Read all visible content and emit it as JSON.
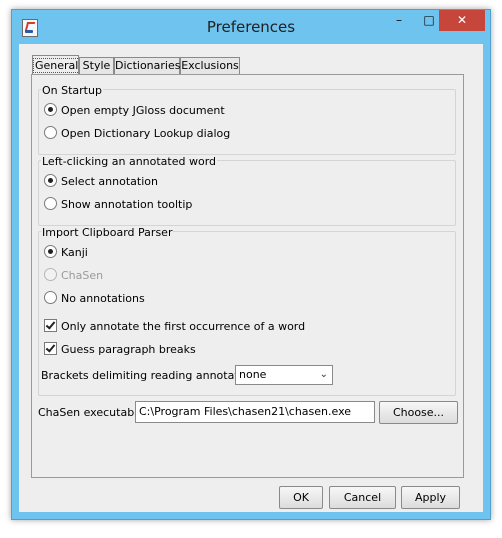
{
  "window": {
    "title": "Preferences"
  },
  "titlebar": {
    "minimize": "–",
    "maximize": "□",
    "close": "✕"
  },
  "tabs": [
    {
      "label": "General",
      "selected": true
    },
    {
      "label": "Style"
    },
    {
      "label": "Dictionaries"
    },
    {
      "label": "Exclusions"
    }
  ],
  "general": {
    "startup": {
      "title": "On Startup",
      "options": [
        "Open empty JGloss document",
        "Open Dictionary Lookup dialog"
      ],
      "selected": 0
    },
    "leftclick": {
      "title": "Left-clicking an annotated word",
      "options": [
        "Select annotation",
        "Show annotation tooltip"
      ],
      "selected": 0
    },
    "clipboard": {
      "title": "Import Clipboard Parser",
      "options": [
        "Kanji",
        "ChaSen",
        "No annotations"
      ],
      "selected": 0,
      "disabled": [
        1
      ],
      "checkboxes": [
        {
          "label": "Only annotate the first occurrence of a word",
          "checked": true
        },
        {
          "label": "Guess paragraph breaks",
          "checked": true
        }
      ],
      "brackets_label": "Brackets delimiting reading annotations:",
      "brackets_value": "none"
    },
    "chasen_label": "ChaSen executable:",
    "chasen_value": "C:\\Program Files\\chasen21\\chasen.exe",
    "choose_label": "Choose..."
  },
  "buttons": {
    "ok": "OK",
    "cancel": "Cancel",
    "apply": "Apply"
  }
}
